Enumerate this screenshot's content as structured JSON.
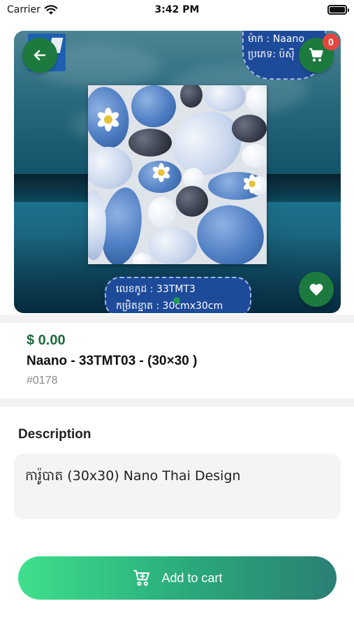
{
  "status_bar": {
    "carrier": "Carrier",
    "time": "3:42 PM"
  },
  "hero": {
    "brand_tag": {
      "line1": "ម៉ាក  : Naano",
      "line2": "ប្រភេទ: ប៉ស៊ី"
    },
    "code_plate": {
      "line1": "លេខកូដ : 33TMT3",
      "line2": "កម្រិតខ្នាត : 30cmx30cm"
    },
    "cart_count": "0",
    "icons": [
      "back-arrow-icon",
      "cart-icon",
      "heart-icon"
    ]
  },
  "product": {
    "price": "$ 0.00",
    "name": "Naano - 33TMT03 - (30×30 )",
    "id": "#0178"
  },
  "description": {
    "heading": "Description",
    "text": "ការ៉ូបាត (30x30) Nano Thai Design"
  },
  "add_to_cart": {
    "label": "Add to cart"
  },
  "colors": {
    "accent_green": "#1c7a3e",
    "price_green": "#1c6b3a",
    "badge_red": "#e8443d"
  }
}
